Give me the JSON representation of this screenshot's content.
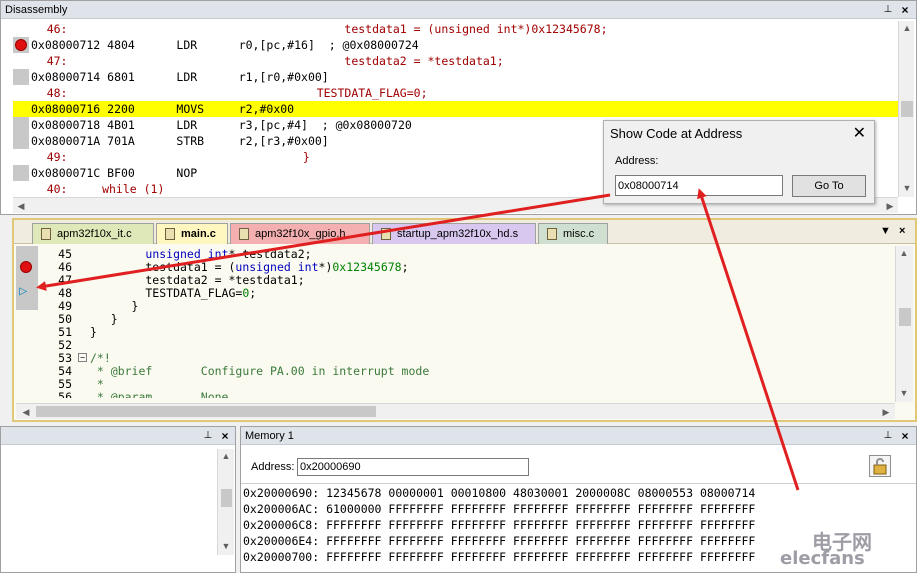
{
  "disassembly": {
    "title": "Disassembly",
    "lines": [
      {
        "type": "src",
        "text": "    46:                                        testdata1 = (unsigned int*)0x12345678;"
      },
      {
        "type": "asm",
        "bp": true,
        "text": "0x08000712 4804      LDR      r0,[pc,#16]  ; @0x08000724"
      },
      {
        "type": "src",
        "text": "    47:                                        testdata2 = *testdata1;"
      },
      {
        "type": "asm",
        "text": "0x08000714 6801      LDR      r1,[r0,#0x00]"
      },
      {
        "type": "src",
        "text": "    48:                                    TESTDATA_FLAG=0;"
      },
      {
        "type": "asm",
        "current": true,
        "text": "0x08000716 2200      MOVS     r2,#0x00"
      },
      {
        "type": "asm",
        "text": "0x08000718 4B01      LDR      r3,[pc,#4]  ; @0x08000720"
      },
      {
        "type": "asm",
        "text": "0x0800071A 701A      STRB     r2,[r3,#0x00]"
      },
      {
        "type": "src",
        "text": "    49:                                  }"
      },
      {
        "type": "asm",
        "text": "0x0800071C BF00      NOP"
      },
      {
        "type": "src",
        "text": "    40:     while (1)"
      }
    ]
  },
  "dialog": {
    "title": "Show Code at Address",
    "close": "✕",
    "address_label": "Address:",
    "address_value": "0x08000714",
    "goto_label": "Go To"
  },
  "editor": {
    "tabs": [
      {
        "label": "apm32f10x_it.c",
        "color": "#dfe8b8"
      },
      {
        "label": "main.c",
        "color": "#fff6c0",
        "active": true
      },
      {
        "label": "apm32f10x_gpio.h",
        "color": "#f4b0b0"
      },
      {
        "label": "startup_apm32f10x_hd.s",
        "color": "#d8c8f0"
      },
      {
        "label": "misc.c",
        "color": "#d0e0d0"
      }
    ],
    "lines": [
      {
        "n": "45",
        "code": "        unsigned int* testdata2;"
      },
      {
        "n": "46",
        "bp": true,
        "code": "        testdata1 = (unsigned int*)0x12345678;"
      },
      {
        "n": "47",
        "code": "        testdata2 = *testdata1;"
      },
      {
        "n": "48",
        "arrow": true,
        "code": "        TESTDATA_FLAG=0;"
      },
      {
        "n": "49",
        "code": "      }"
      },
      {
        "n": "50",
        "code": "   }"
      },
      {
        "n": "51",
        "code": "}"
      },
      {
        "n": "52",
        "code": ""
      },
      {
        "n": "53",
        "fold": true,
        "code": "/*!"
      },
      {
        "n": "54",
        "code": " * @brief       Configure PA.00 in interrupt mode"
      },
      {
        "n": "55",
        "code": " *"
      },
      {
        "n": "56",
        "code": " * @param       None"
      }
    ]
  },
  "memory": {
    "title": "Memory 1",
    "address_label": "Address:",
    "address_value": "0x20000690",
    "rows": [
      "0x20000690: 12345678 00000001 00010800 48030001 2000008C 08000553 08000714",
      "0x200006AC: 61000000 FFFFFFFF FFFFFFFF FFFFFFFF FFFFFFFF FFFFFFFF FFFFFFFF",
      "0x200006C8: FFFFFFFF FFFFFFFF FFFFFFFF FFFFFFFF FFFFFFFF FFFFFFFF FFFFFFFF",
      "0x200006E4: FFFFFFFF FFFFFFFF FFFFFFFF FFFFFFFF FFFFFFFF FFFFFFFF FFFFFFFF",
      "0x20000700: FFFFFFFF FFFFFFFF FFFFFFFF FFFFFFFF FFFFFFFF FFFFFFFF FFFFFFFF"
    ]
  },
  "watermark": {
    "line1": "电子网",
    "line2": "elecfans"
  },
  "colors": {
    "highlight": "#ffff00",
    "arrow": "#e02020",
    "breakpoint": "#e01010"
  }
}
